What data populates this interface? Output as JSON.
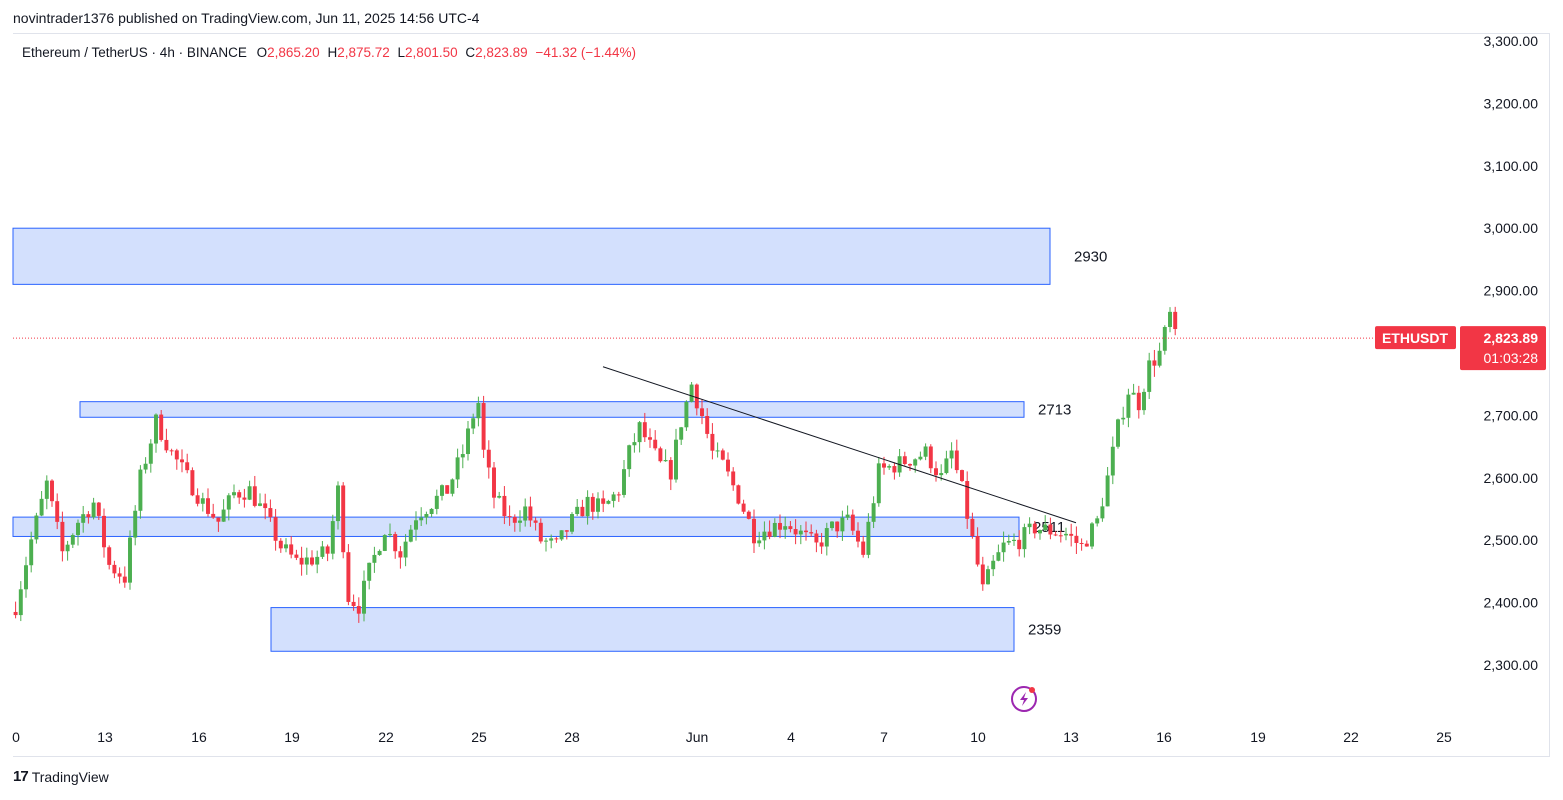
{
  "header": {
    "published": "novintrader1376 published on TradingView.com, Jun 11, 2025 14:56 UTC-4"
  },
  "legend": {
    "symbol": "Ethereum / TetherUS · 4h · BINANCE",
    "o_label": "O",
    "o": "2,865.20",
    "h_label": "H",
    "h": "2,875.72",
    "l_label": "L",
    "l": "2,801.50",
    "c_label": "C",
    "c": "2,823.89",
    "change": "−41.32 (−1.44%)"
  },
  "price_tag": {
    "symbol": "ETHUSDT",
    "price": "2,823.89",
    "countdown": "01:03:28"
  },
  "footer": {
    "brand": "TradingView",
    "logo_icon": "tradingview-logo-icon"
  },
  "colors": {
    "up": "#089981",
    "down": "#f23645",
    "zone_fill": "#d1defd",
    "zone_stroke": "#2962ff",
    "candle_up": "#4caf50"
  },
  "chart_data": {
    "type": "candlestick",
    "timeframe": "4h",
    "ylim": [
      2230,
      3310
    ],
    "y_ticks": [
      "3,300.00",
      "3,200.00",
      "3,100.00",
      "3,000.00",
      "2,900.00",
      "2,800.00",
      "2,700.00",
      "2,600.00",
      "2,500.00",
      "2,400.00",
      "2,300.00"
    ],
    "y_tick_values": [
      3300,
      3200,
      3100,
      3000,
      2900,
      2800,
      2700,
      2600,
      2500,
      2400,
      2300
    ],
    "x_ticks": [
      "0",
      "13",
      "16",
      "19",
      "22",
      "25",
      "28",
      "Jun",
      "4",
      "7",
      "10",
      "13",
      "16",
      "19",
      "22",
      "25"
    ],
    "current_price": 2823.89,
    "zones": [
      {
        "label": "2930",
        "top": 3000,
        "bottom": 2910,
        "x_start": "May 9",
        "x_end": "Jun 12"
      },
      {
        "label": "2713",
        "top": 2722,
        "bottom": 2697,
        "x_start": "May 12",
        "x_end": "Jun 11"
      },
      {
        "label": "2511",
        "top": 2537,
        "bottom": 2506,
        "x_start": "May 9",
        "x_end": "Jun 11"
      },
      {
        "label": "2359",
        "top": 2392,
        "bottom": 2322,
        "x_start": "May 18",
        "x_end": "Jun 11"
      }
    ],
    "trendline": {
      "from": {
        "date": "May 29",
        "price": 2778
      },
      "to": {
        "date": "Jun 12",
        "price": 2528
      }
    },
    "close_path": [
      [
        0,
        2395
      ],
      [
        3,
        2500
      ],
      [
        6,
        2590
      ],
      [
        9,
        2480
      ],
      [
        12,
        2530
      ],
      [
        15,
        2560
      ],
      [
        18,
        2460
      ],
      [
        21,
        2440
      ],
      [
        24,
        2600
      ],
      [
        27,
        2690
      ],
      [
        30,
        2640
      ],
      [
        33,
        2600
      ],
      [
        36,
        2560
      ],
      [
        39,
        2530
      ],
      [
        42,
        2575
      ],
      [
        45,
        2580
      ],
      [
        48,
        2540
      ],
      [
        51,
        2490
      ],
      [
        54,
        2465
      ],
      [
        57,
        2470
      ],
      [
        60,
        2480
      ],
      [
        62,
        2580
      ],
      [
        64,
        2410
      ],
      [
        66,
        2395
      ],
      [
        68,
        2450
      ],
      [
        71,
        2520
      ],
      [
        74,
        2480
      ],
      [
        77,
        2540
      ],
      [
        80,
        2560
      ],
      [
        83,
        2580
      ],
      [
        86,
        2640
      ],
      [
        88,
        2700
      ],
      [
        89,
        2720
      ],
      [
        90,
        2640
      ],
      [
        92,
        2570
      ],
      [
        95,
        2530
      ],
      [
        98,
        2550
      ],
      [
        101,
        2500
      ],
      [
        104,
        2490
      ],
      [
        107,
        2530
      ],
      [
        110,
        2560
      ],
      [
        113,
        2550
      ],
      [
        116,
        2580
      ],
      [
        118,
        2640
      ],
      [
        120,
        2680
      ],
      [
        122,
        2650
      ],
      [
        124,
        2620
      ],
      [
        126,
        2610
      ],
      [
        128,
        2690
      ],
      [
        130,
        2750
      ],
      [
        132,
        2700
      ],
      [
        134,
        2640
      ],
      [
        136,
        2620
      ],
      [
        139,
        2570
      ],
      [
        142,
        2510
      ],
      [
        145,
        2520
      ],
      [
        148,
        2530
      ],
      [
        151,
        2510
      ],
      [
        154,
        2490
      ],
      [
        157,
        2520
      ],
      [
        160,
        2530
      ],
      [
        163,
        2480
      ],
      [
        166,
        2610
      ],
      [
        169,
        2620
      ],
      [
        172,
        2630
      ],
      [
        175,
        2640
      ],
      [
        178,
        2600
      ],
      [
        180,
        2640
      ],
      [
        182,
        2580
      ],
      [
        184,
        2500
      ],
      [
        186,
        2420
      ],
      [
        188,
        2460
      ],
      [
        190,
        2490
      ],
      [
        193,
        2500
      ],
      [
        196,
        2520
      ],
      [
        199,
        2515
      ],
      [
        202,
        2510
      ],
      [
        205,
        2490
      ],
      [
        208,
        2530
      ],
      [
        210,
        2600
      ],
      [
        212,
        2680
      ],
      [
        214,
        2740
      ],
      [
        216,
        2720
      ],
      [
        218,
        2780
      ],
      [
        220,
        2800
      ],
      [
        222,
        2860
      ],
      [
        223,
        2823.89
      ]
    ]
  }
}
